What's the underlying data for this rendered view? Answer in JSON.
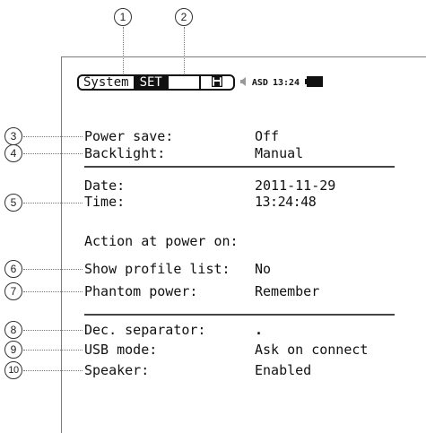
{
  "callouts": [
    "1",
    "2",
    "3",
    "4",
    "5",
    "6",
    "7",
    "8",
    "9",
    "10"
  ],
  "status_bar": {
    "tab_system": "System",
    "tab_set": "SET",
    "mic_label": "ASD",
    "clock": "13:24",
    "icons": [
      "save-icon",
      "speaker-icon",
      "battery-icon"
    ]
  },
  "settings": {
    "power_save": {
      "label": "Power save:",
      "value": "Off"
    },
    "backlight": {
      "label": "Backlight:",
      "value": "Manual"
    },
    "date": {
      "label": "Date:",
      "value": "2011-11-29"
    },
    "time": {
      "label": "Time:",
      "value": "13:24:48"
    },
    "action_heading": "Action at power on:",
    "show_profile_list": {
      "label": "Show profile list:",
      "value": "No"
    },
    "phantom_power": {
      "label": "Phantom power:",
      "value": "Remember"
    },
    "dec_separator": {
      "label": "Dec. separator:",
      "value": "."
    },
    "usb_mode": {
      "label": "USB mode:",
      "value": "Ask on connect"
    },
    "speaker": {
      "label": "Speaker:",
      "value": "Enabled"
    }
  },
  "colors": {
    "text": "#111111",
    "frame": "#7a7a7a",
    "leader": "#777777"
  }
}
